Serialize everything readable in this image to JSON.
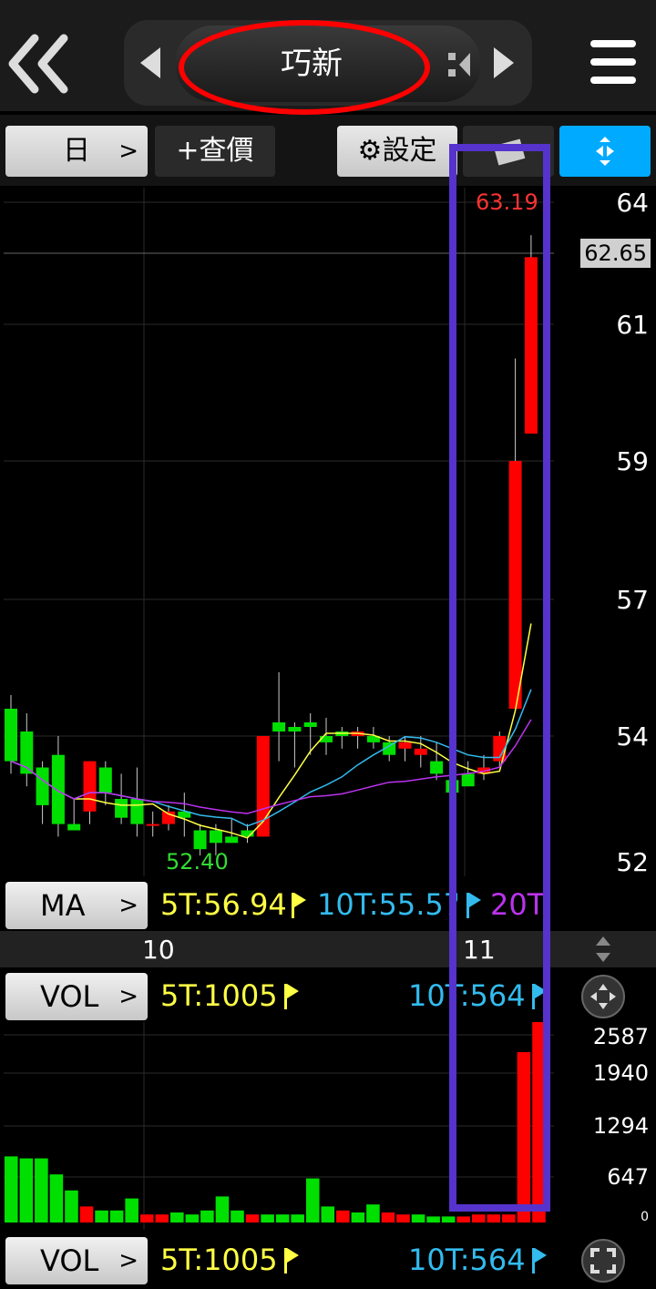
{
  "header": {
    "stock_name": "巧新",
    "back_icon": "double-chevron-left-icon",
    "menu_icon": "hamburger-menu-icon"
  },
  "toolbar": {
    "period_label": "日",
    "quote_label": "+查價",
    "settings_label": "設定"
  },
  "price_chart": {
    "high_label": "63.19",
    "low_label": "52.40",
    "current_price": "62.65",
    "y_ticks": [
      "64",
      "61",
      "59",
      "57",
      "54",
      "52"
    ]
  },
  "ma_row": {
    "button_label": "MA",
    "ma5": "5T:56.94",
    "ma10": "10T:55.57",
    "ma20": "20T"
  },
  "dates": {
    "left": "10",
    "right": "11"
  },
  "vol_row_top": {
    "button_label": "VOL",
    "vol5": "5T:1005",
    "vol10": "10T:564"
  },
  "vol_chart": {
    "y_ticks": [
      "2587",
      "1940",
      "1294",
      "647",
      "0"
    ]
  },
  "vol_row_bottom": {
    "button_label": "VOL",
    "vol5": "5T:1005",
    "vol10": "10T:564"
  },
  "colors": {
    "up": "#ff0000",
    "down": "#00e000",
    "ma5": "#ffff44",
    "ma10": "#33bbee",
    "ma20": "#bb33ee",
    "highlight": "#5533cc",
    "accent": "#00aaff"
  },
  "chart_data": {
    "type": "candlestick",
    "candles": [
      {
        "o": 54.6,
        "h": 54.9,
        "c": 53.6,
        "l": 53.4
      },
      {
        "o": 54.1,
        "h": 54.5,
        "c": 53.4,
        "l": 53.2
      },
      {
        "o": 53.5,
        "h": 53.6,
        "c": 52.9,
        "l": 52.6
      },
      {
        "o": 53.7,
        "h": 54.0,
        "c": 52.6,
        "l": 52.4
      },
      {
        "o": 52.6,
        "h": 53.0,
        "c": 52.5,
        "l": 52.5
      },
      {
        "o": 52.8,
        "h": 53.6,
        "c": 53.6,
        "l": 52.6
      },
      {
        "o": 53.5,
        "h": 53.6,
        "c": 53.1,
        "l": 52.9
      },
      {
        "o": 53.0,
        "h": 53.4,
        "c": 52.7,
        "l": 52.6
      },
      {
        "o": 53.0,
        "h": 53.5,
        "c": 52.6,
        "l": 52.4
      },
      {
        "o": 52.6,
        "h": 52.8,
        "c": 52.6,
        "l": 52.4
      },
      {
        "o": 52.6,
        "h": 52.9,
        "c": 52.8,
        "l": 52.5
      },
      {
        "o": 52.8,
        "h": 53.1,
        "c": 52.7,
        "l": 52.4
      },
      {
        "o": 52.5,
        "h": 52.6,
        "c": 52.2,
        "l": 52.1
      },
      {
        "o": 52.5,
        "h": 52.6,
        "c": 52.3,
        "l": 52.1
      },
      {
        "o": 52.4,
        "h": 52.7,
        "c": 52.3,
        "l": 52.3
      },
      {
        "o": 52.5,
        "h": 52.6,
        "c": 52.4,
        "l": 52.3
      },
      {
        "o": 52.4,
        "h": 54.0,
        "c": 54.0,
        "l": 52.4
      },
      {
        "o": 54.3,
        "h": 55.4,
        "c": 54.1,
        "l": 53.6
      },
      {
        "o": 54.2,
        "h": 54.3,
        "c": 54.1,
        "l": 53.5
      },
      {
        "o": 54.3,
        "h": 54.5,
        "c": 54.2,
        "l": 53.7
      },
      {
        "o": 54.0,
        "h": 54.4,
        "c": 53.9,
        "l": 53.7
      },
      {
        "o": 54.1,
        "h": 54.2,
        "c": 54.0,
        "l": 53.8
      },
      {
        "o": 54.0,
        "h": 54.2,
        "c": 54.1,
        "l": 53.8
      },
      {
        "o": 54.0,
        "h": 54.2,
        "c": 53.9,
        "l": 53.8
      },
      {
        "o": 53.9,
        "h": 54.0,
        "c": 53.7,
        "l": 53.6
      },
      {
        "o": 53.8,
        "h": 54.0,
        "c": 53.9,
        "l": 53.6
      },
      {
        "o": 53.7,
        "h": 54.0,
        "c": 53.8,
        "l": 53.5
      },
      {
        "o": 53.6,
        "h": 53.9,
        "c": 53.4,
        "l": 53.3
      },
      {
        "o": 53.3,
        "h": 53.6,
        "c": 53.1,
        "l": 53.1
      },
      {
        "o": 53.4,
        "h": 53.6,
        "c": 53.2,
        "l": 53.2
      },
      {
        "o": 53.4,
        "h": 53.7,
        "c": 53.5,
        "l": 53.3
      },
      {
        "o": 53.6,
        "h": 54.1,
        "c": 54.0,
        "l": 53.5
      },
      {
        "o": 54.6,
        "h": 60.5,
        "c": 59.0,
        "l": 54.6
      },
      {
        "o": 59.4,
        "h": 63.19,
        "c": 62.65,
        "l": 59.4
      }
    ],
    "volumes": [
      0.33,
      0.32,
      0.32,
      0.24,
      0.16,
      0.08,
      0.06,
      0.06,
      0.12,
      0.04,
      0.04,
      0.05,
      0.04,
      0.06,
      0.13,
      0.06,
      0.04,
      0.04,
      0.04,
      0.04,
      0.22,
      0.08,
      0.06,
      0.05,
      0.09,
      0.05,
      0.04,
      0.04,
      0.03,
      0.03,
      0.03,
      0.04,
      0.04,
      0.04,
      0.85,
      1.0
    ]
  }
}
